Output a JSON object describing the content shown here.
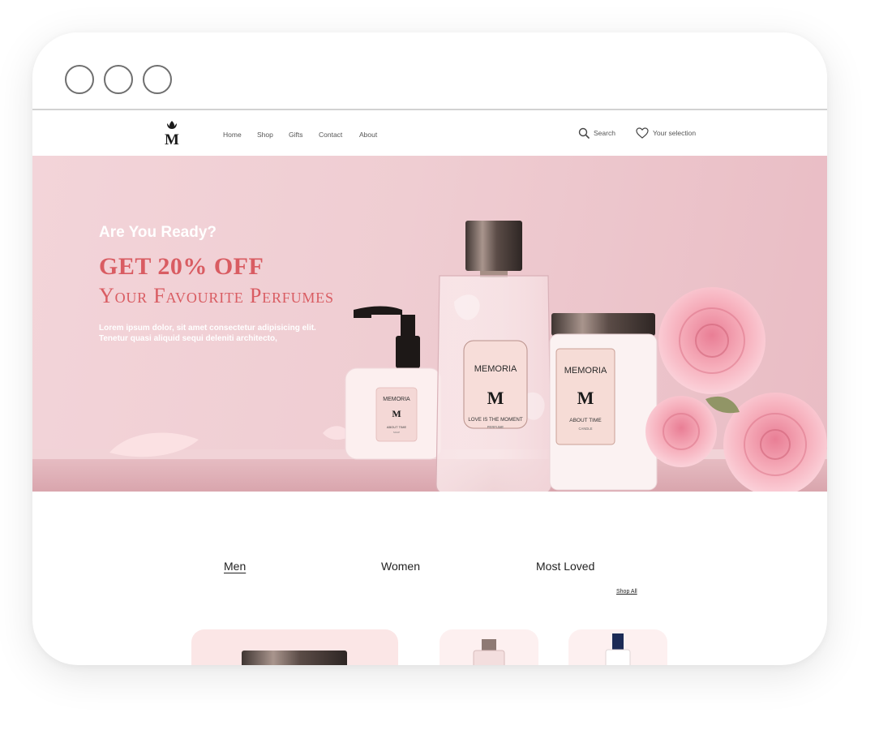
{
  "window": {
    "controls": [
      "window-control-1",
      "window-control-2",
      "window-control-3"
    ]
  },
  "nav": {
    "brand": "M",
    "links": [
      "Home",
      "Shop",
      "Gifts",
      "Contact",
      "About"
    ],
    "search_label": "Search",
    "selection_label": "Your selection"
  },
  "hero": {
    "eyebrow": "Are You Ready?",
    "title": "GET 20% OFF",
    "subtitle": "Your Favourite Perfumes",
    "description_line1": "Lorem ipsum dolor, sit amet consectetur adipisicing elit.",
    "description_line2": "Tenetur quasi aliquid sequi deleniti architecto,",
    "products": {
      "soap": {
        "brand": "MEMORIA",
        "name": "ABOUT TIME",
        "type": "SOAP"
      },
      "perfume": {
        "brand": "MEMORIA",
        "name": "LOVE IS THE MOMENT",
        "type": "PERFUME"
      },
      "candle": {
        "brand": "MEMORIA",
        "name": "ABOUT TIME",
        "type": "CANDLE"
      }
    }
  },
  "categories": {
    "tabs": [
      "Men",
      "Women",
      "Most Loved"
    ],
    "active": "Men",
    "shop_all": "Shop All"
  },
  "colors": {
    "accent": "#d95c62",
    "hero_bg": "#efcdd2",
    "card_bg": "#fbe6e6"
  }
}
